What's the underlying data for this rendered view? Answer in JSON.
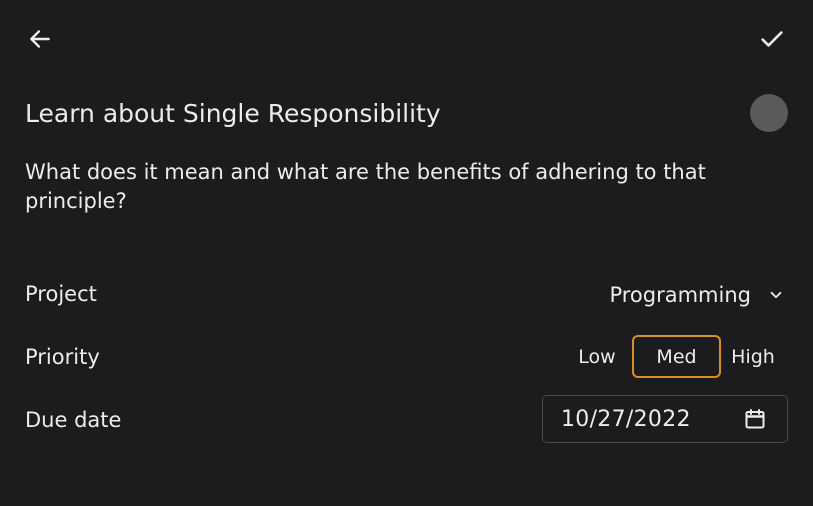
{
  "header": {
    "back_icon": "arrow-left-icon",
    "done_icon": "check-icon"
  },
  "task": {
    "title": "Learn about Single Responsibility",
    "description": "What does it mean and what are the benefits of adhering to that principle?",
    "completed": false
  },
  "fields": {
    "project_label": "Project",
    "project_value": "Programming",
    "priority_label": "Priority",
    "priority_options": [
      "Low",
      "Med",
      "High"
    ],
    "priority_selected": "Med",
    "due_label": "Due date",
    "due_value": "10/27/2022"
  },
  "colors": {
    "background": "#1c1c1e",
    "accent": "#d98f26",
    "toggle": "#5a5a5c"
  }
}
